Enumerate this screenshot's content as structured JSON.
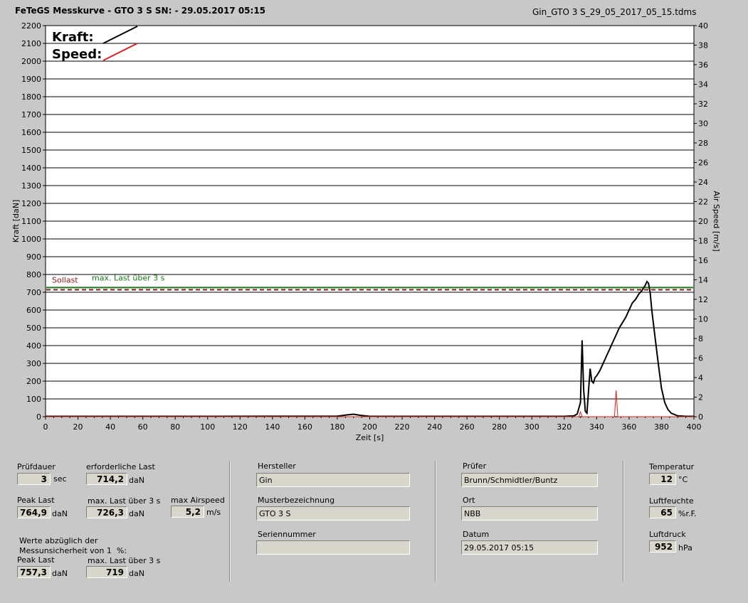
{
  "header": {
    "title": "FeTeGS Messkurve - GTO 3  S  SN:  - 29.05.2017 05:15",
    "filename": "Gin_GTO 3  S_29_05_2017_05_15.tdms"
  },
  "colors": {
    "kraft": "#000000",
    "speed": "#e02020",
    "sollast": "#8b1a1a",
    "maxlast": "#1a7a1a"
  },
  "chart_data": {
    "type": "line",
    "xlabel": "Zeit [s]",
    "ylabel": "Kraft [daN]",
    "y2label": "Air Speed [m/s]",
    "xlim": [
      0,
      400
    ],
    "ylim": [
      0,
      2200
    ],
    "y2lim": [
      0,
      40
    ],
    "x_ticks": [
      0,
      20,
      40,
      60,
      80,
      100,
      120,
      140,
      160,
      180,
      200,
      220,
      240,
      260,
      280,
      300,
      320,
      340,
      360,
      380,
      400
    ],
    "y_ticks": [
      0,
      100,
      200,
      300,
      400,
      500,
      600,
      700,
      800,
      900,
      1000,
      1100,
      1200,
      1300,
      1400,
      1500,
      1600,
      1700,
      1800,
      1900,
      2000,
      2100,
      2200
    ],
    "y2_ticks": [
      0,
      2,
      4,
      6,
      8,
      10,
      12,
      14,
      16,
      18,
      20,
      22,
      24,
      26,
      28,
      30,
      32,
      34,
      36,
      38,
      40
    ],
    "grid": "horizontal",
    "legend": [
      {
        "label": "Kraft:",
        "color": "#000000"
      },
      {
        "label": "Speed:",
        "color": "#e02020"
      }
    ],
    "reference_lines": [
      {
        "label": "Sollast",
        "y": 714.2,
        "color": "#8b1a1a",
        "style": "dashed"
      },
      {
        "label": "max. Last über  3 s",
        "y": 726.3,
        "color": "#1a7a1a",
        "style": "solid"
      }
    ],
    "series": [
      {
        "name": "Kraft",
        "axis": "left",
        "points": [
          [
            0,
            2
          ],
          [
            100,
            2
          ],
          [
            180,
            3
          ],
          [
            186,
            10
          ],
          [
            190,
            14
          ],
          [
            194,
            8
          ],
          [
            200,
            2
          ],
          [
            300,
            2
          ],
          [
            320,
            2
          ],
          [
            326,
            5
          ],
          [
            328,
            15
          ],
          [
            330,
            80
          ],
          [
            331,
            430
          ],
          [
            332,
            150
          ],
          [
            333,
            30
          ],
          [
            334,
            20
          ],
          [
            335,
            150
          ],
          [
            336,
            270
          ],
          [
            337,
            200
          ],
          [
            338,
            190
          ],
          [
            339,
            220
          ],
          [
            340,
            230
          ],
          [
            342,
            260
          ],
          [
            344,
            300
          ],
          [
            346,
            340
          ],
          [
            348,
            380
          ],
          [
            350,
            420
          ],
          [
            352,
            460
          ],
          [
            354,
            500
          ],
          [
            356,
            530
          ],
          [
            358,
            560
          ],
          [
            360,
            600
          ],
          [
            362,
            640
          ],
          [
            364,
            660
          ],
          [
            366,
            690
          ],
          [
            368,
            710
          ],
          [
            370,
            740
          ],
          [
            371,
            760
          ],
          [
            372,
            750
          ],
          [
            373,
            700
          ],
          [
            374,
            600
          ],
          [
            376,
            450
          ],
          [
            378,
            300
          ],
          [
            380,
            160
          ],
          [
            382,
            80
          ],
          [
            384,
            40
          ],
          [
            386,
            20
          ],
          [
            390,
            5
          ],
          [
            395,
            2
          ],
          [
            400,
            2
          ]
        ]
      },
      {
        "name": "Speed",
        "axis": "right",
        "points": [
          [
            0,
            0
          ],
          [
            329,
            0
          ],
          [
            330,
            0.5
          ],
          [
            331,
            0
          ],
          [
            351,
            0
          ],
          [
            352,
            2.7
          ],
          [
            353,
            0
          ],
          [
            400,
            0
          ]
        ]
      }
    ]
  },
  "info": {
    "pruefdauer": {
      "label": "Prüfdauer",
      "value": "3",
      "unit": "sec"
    },
    "erforderliche_last": {
      "label": "erforderliche Last",
      "value": "714,2",
      "unit": "daN"
    },
    "peak_last": {
      "label": "Peak Last",
      "value": "764,9",
      "unit": "daN"
    },
    "max_last": {
      "label": "max. Last über  3 s",
      "value": "726,3",
      "unit": "daN"
    },
    "max_airspeed": {
      "label": "max Airspeed",
      "value": "5,2",
      "unit": "m/s"
    },
    "note": "Werte abzüglich der\nMessunsicherheit von 1  %:",
    "peak_last_corr": {
      "label": "Peak Last",
      "value": "757,3",
      "unit": "daN"
    },
    "max_last_corr": {
      "label": "max. Last über  3 s",
      "value": "719",
      "unit": "daN"
    },
    "hersteller": {
      "label": "Hersteller",
      "value": "Gin"
    },
    "musterbezeichnung": {
      "label": "Musterbezeichnung",
      "value": "GTO 3  S"
    },
    "seriennummer": {
      "label": "Seriennummer",
      "value": ""
    },
    "pruefer": {
      "label": "Prüfer",
      "value": "Brunn/Schmidtler/Buntz"
    },
    "ort": {
      "label": "Ort",
      "value": "NBB"
    },
    "datum": {
      "label": "Datum",
      "value": "29.05.2017 05:15"
    },
    "temperatur": {
      "label": "Temperatur",
      "value": "12",
      "unit": "°C"
    },
    "luftfeuchte": {
      "label": "Luftfeuchte",
      "value": "65",
      "unit": "%r.F."
    },
    "luftdruck": {
      "label": "Luftdruck",
      "value": "952",
      "unit": "hPa"
    }
  }
}
